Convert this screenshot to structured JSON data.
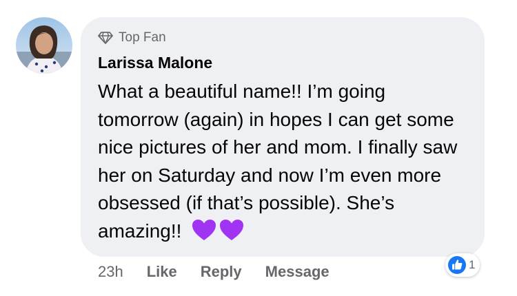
{
  "comment": {
    "badge_label": "Top Fan",
    "badge_icon": "diamond-icon",
    "author": "Larissa Malone",
    "text": "What a beautiful name!! I’m going tomorrow (again) in hopes I can get some nice pictures of her and mom. I finally saw her on Saturday and now I’m even more obsessed (if that’s possible). She’s amazing!!",
    "emoji": [
      "purple-heart",
      "purple-heart"
    ],
    "time": "23h",
    "actions": {
      "like": "Like",
      "reply": "Reply",
      "message": "Message"
    },
    "reactions": {
      "icon": "thumbs-up-icon",
      "count": "1"
    }
  },
  "colors": {
    "bubble_bg": "#eef0f3",
    "muted_text": "#65676b",
    "like_blue": "#1877f2",
    "heart_purple": "#a133f2"
  }
}
